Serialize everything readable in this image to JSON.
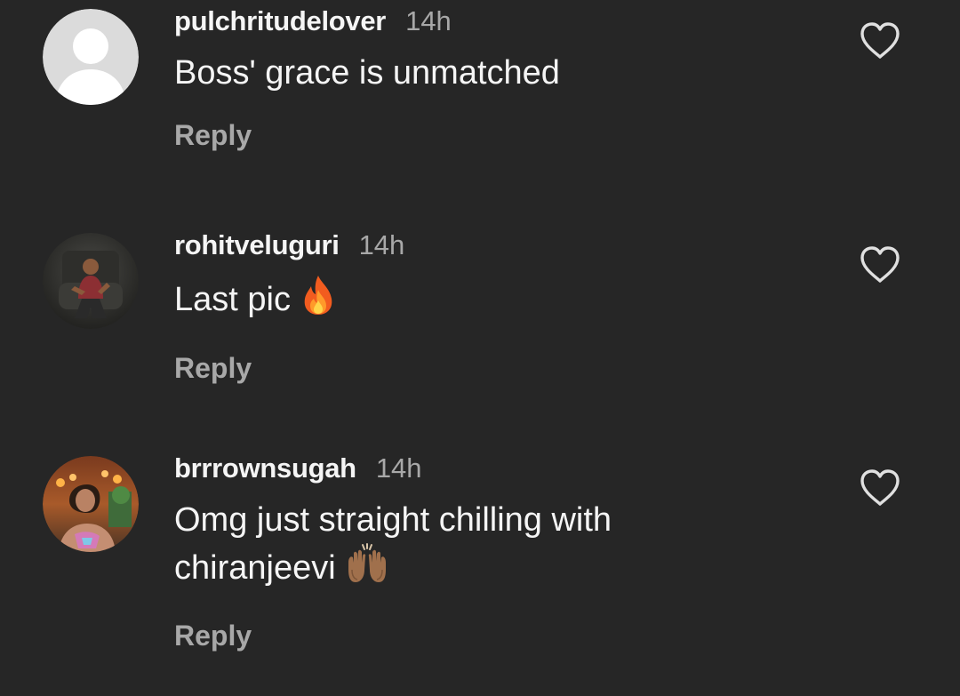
{
  "comments": [
    {
      "username": "pulchritudelover",
      "time": "14h",
      "text": "Boss' grace is unmatched",
      "emoji": "",
      "reply_label": "Reply",
      "avatar": "default-avatar-icon",
      "like_icon": "heart-outline-icon"
    },
    {
      "username": "rohitveluguri",
      "time": "14h",
      "text": "Last pic",
      "emoji": "fire-emoji",
      "reply_label": "Reply",
      "avatar": "user-photo-avatar",
      "like_icon": "heart-outline-icon"
    },
    {
      "username": "brrrownsugah",
      "time": "14h",
      "text_line1": "Omg just straight chilling with",
      "text_line2": "chiranjeevi",
      "emoji": "raising-hands-emoji",
      "reply_label": "Reply",
      "avatar": "user-photo-avatar",
      "like_icon": "heart-outline-icon"
    }
  ],
  "colors": {
    "background": "#262626",
    "primary_text": "#f5f5f5",
    "secondary_text": "#a8a8a8"
  }
}
